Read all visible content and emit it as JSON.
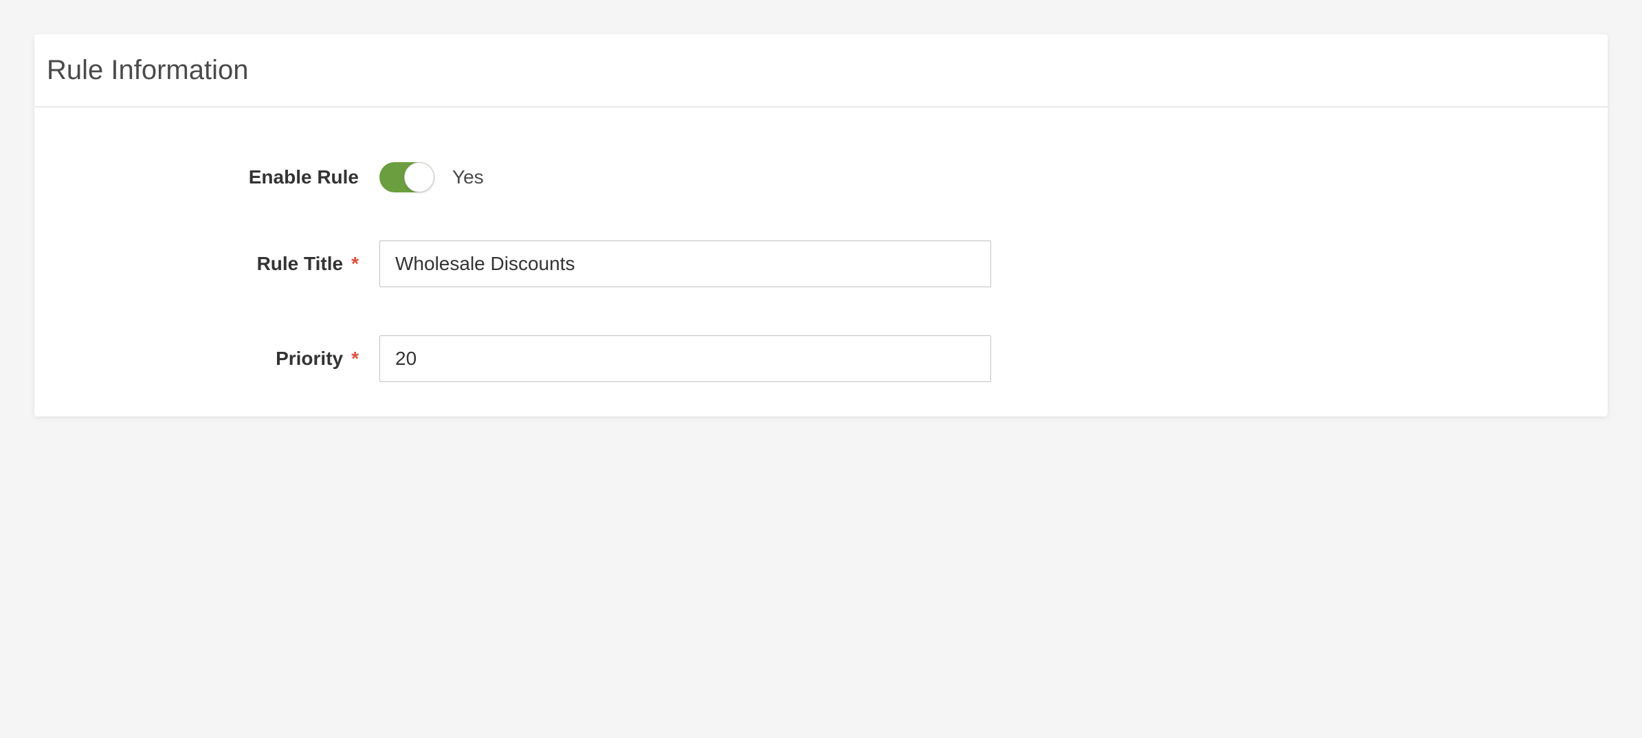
{
  "panel": {
    "title": "Rule Information"
  },
  "form": {
    "enable_rule": {
      "label": "Enable Rule",
      "value_label": "Yes",
      "enabled": true
    },
    "rule_title": {
      "label": "Rule Title",
      "value": "Wholesale Discounts",
      "required": true
    },
    "priority": {
      "label": "Priority",
      "value": "20",
      "required": true
    }
  },
  "symbols": {
    "asterisk": "*"
  }
}
